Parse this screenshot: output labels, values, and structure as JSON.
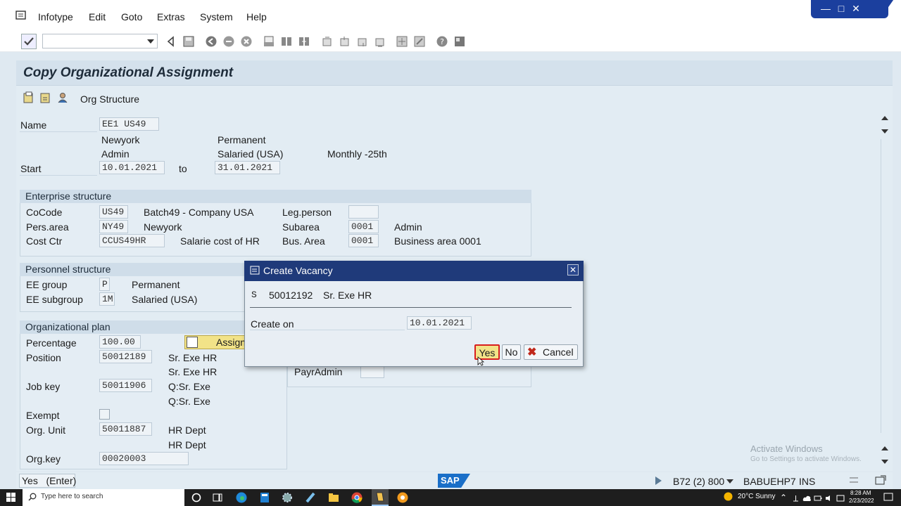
{
  "menu": [
    "Infotype",
    "Edit",
    "Goto",
    "Extras",
    "System",
    "Help"
  ],
  "window_controls": {
    "minimize": "—",
    "maximize": "□",
    "close": "✕"
  },
  "title": "Copy Organizational Assignment",
  "app_toolbar": {
    "org_structure": "Org Structure"
  },
  "header": {
    "name_label": "Name",
    "name_value": "EE1 US49",
    "loc": "Newyork",
    "dept": "Admin",
    "perm": "Permanent",
    "salaried": "Salaried (USA)",
    "payroll": "Monthly -25th",
    "start_label": "Start",
    "start_value": "10.01.2021",
    "to_label": "to",
    "end_value": "31.01.2021"
  },
  "enterprise": {
    "heading": "Enterprise structure",
    "cocode_label": "CoCode",
    "cocode_value": "US49",
    "cocode_text": "Batch49 - Company USA",
    "persarea_label": "Pers.area",
    "persarea_value": "NY49",
    "persarea_text": "Newyork",
    "costctr_label": "Cost Ctr",
    "costctr_value": "CCUS49HR",
    "costctr_text": "Salarie cost of HR",
    "legperson_label": "Leg.person",
    "legperson_value": "",
    "subarea_label": "Subarea",
    "subarea_value": "0001",
    "subarea_text": "Admin",
    "busarea_label": "Bus. Area",
    "busarea_value": "0001",
    "busarea_text": "Business area 0001"
  },
  "personnel": {
    "heading": "Personnel structure",
    "eegroup_label": "EE group",
    "eegroup_value": "P",
    "eegroup_text": "Permanent",
    "eesub_label": "EE subgroup",
    "eesub_value": "1M",
    "eesub_text": "Salaried (USA)"
  },
  "orgplan": {
    "heading": "Organizational plan",
    "assign_button": "Assign",
    "percentage_label": "Percentage",
    "percentage_value": "100.00",
    "position_label": "Position",
    "position_value": "50012189",
    "position_text1": "Sr. Exe HR",
    "position_text2": "Sr. Exe HR",
    "jobkey_label": "Job key",
    "jobkey_value": "50011906",
    "jobkey_text1": "Q:Sr. Exe",
    "jobkey_text2": "Q:Sr. Exe",
    "exempt_label": "Exempt",
    "orgunit_label": "Org. Unit",
    "orgunit_value": "50011887",
    "orgunit_text1": "HR Dept",
    "orgunit_text2": "HR Dept",
    "orgkey_label": "Org.key",
    "orgkey_value": "00020003"
  },
  "right_group": {
    "payradmin_label": "PayrAdmin",
    "payradmin_value": ""
  },
  "dialog": {
    "title": "Create Vacancy",
    "object_type": "S",
    "object_id": "50012192",
    "object_text": "Sr. Exe HR",
    "createon_label": "Create on",
    "createon_value": "10.01.2021",
    "yes": "Yes",
    "no": "No",
    "cancel": "Cancel"
  },
  "status": {
    "message": "Yes   (Enter)",
    "system": "B72 (2) 800",
    "server": "BABUEHP7",
    "mode": "INS"
  },
  "watermark": {
    "line1": "Activate Windows",
    "line2": "Go to Settings to activate Windows."
  },
  "taskbar": {
    "search_placeholder": "Type here to search",
    "weather": "20°C  Sunny",
    "time": "8:28 AM",
    "date": "2/23/2022"
  },
  "colors": {
    "dialog_header": "#1f3a7a",
    "yes_highlight": "#d81e1e",
    "window_controls": "#1b3f9e"
  }
}
